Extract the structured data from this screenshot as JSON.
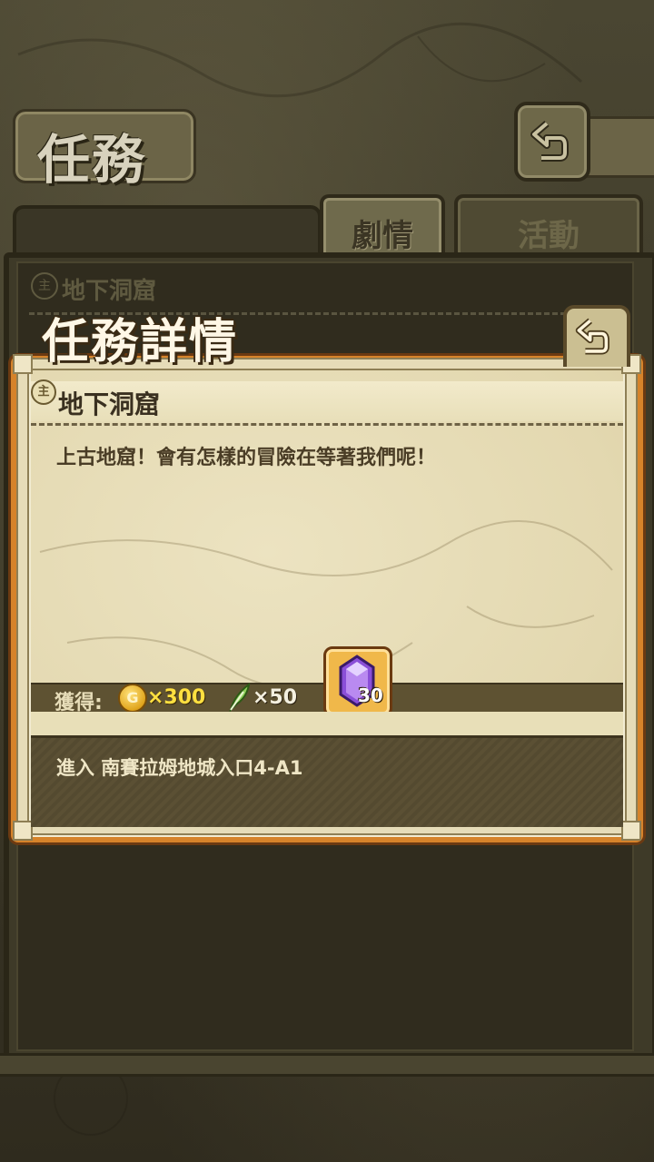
{
  "header": {
    "title": "任務"
  },
  "tabs": [
    {
      "label": "劇情",
      "active": true
    },
    {
      "label": "活動",
      "active": false
    }
  ],
  "background_list": {
    "item_icon": "主",
    "item_title": "地下洞窟"
  },
  "modal": {
    "title": "任務詳情",
    "quest_icon": "主",
    "quest_name": "地下洞窟",
    "description": "上古地窟！會有怎樣的冒險在等著我們呢！",
    "reward_label": "獲得:",
    "coin_symbol": "G",
    "coin_amount": "×300",
    "feather_amount": "×50",
    "gem_count": "30",
    "objective": "進入 南賽拉姆地城入口4-A1"
  },
  "icons": {
    "top_back": "return-arrow-icon",
    "modal_back": "return-arrow-icon",
    "coin": "gold-coin-icon",
    "feather": "feather-icon",
    "gem": "purple-crystal-icon"
  },
  "colors": {
    "modal_border": "#d6832a",
    "coin_text": "#ffe040",
    "gem": "#9a5ee0"
  }
}
